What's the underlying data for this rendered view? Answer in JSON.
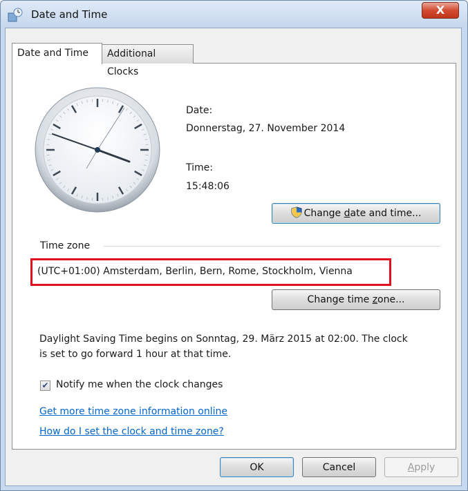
{
  "window": {
    "title": "Date and Time",
    "close_label": "X"
  },
  "tabs": [
    {
      "label": "Date and Time",
      "active": true
    },
    {
      "label": "Additional Clocks",
      "active": false
    }
  ],
  "date": {
    "label": "Date:",
    "value": "Donnerstag, 27. November 2014"
  },
  "time": {
    "label": "Time:",
    "value": "15:48:06"
  },
  "change_datetime": {
    "prefix": "Change ",
    "underlined": "d",
    "suffix": "ate and time..."
  },
  "timezone": {
    "group_label": "Time zone",
    "value": "(UTC+01:00) Amsterdam, Berlin, Bern, Rome, Stockholm, Vienna",
    "highlight_color": "#e0101c"
  },
  "change_timezone": {
    "prefix": "Change time ",
    "underlined": "z",
    "suffix": "one..."
  },
  "dst_text": {
    "line1": "Daylight Saving Time begins on Sonntag, 29. März 2015 at 02:00. The clock",
    "line2": "is set to go forward 1 hour at that time."
  },
  "notify": {
    "label": "Notify me when the clock changes",
    "checked": true,
    "check_glyph": "✔"
  },
  "links": {
    "more_info": "Get more time zone information online",
    "how_set": "How do I set the clock and time zone?"
  },
  "buttons": {
    "ok": "OK",
    "cancel": "Cancel",
    "apply_underlined": "A",
    "apply_rest": "pply"
  }
}
